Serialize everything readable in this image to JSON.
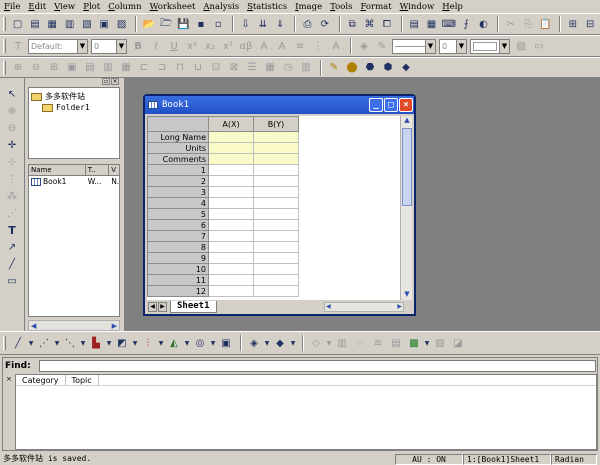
{
  "menu": [
    "File",
    "Edit",
    "View",
    "Plot",
    "Column",
    "Worksheet",
    "Analysis",
    "Statistics",
    "Image",
    "Tools",
    "Format",
    "Window",
    "Help"
  ],
  "format_toolbar": {
    "font": "Default:",
    "size": "0",
    "width": "0"
  },
  "explorer": {
    "root": "多多软件站",
    "folder": "Folder1",
    "columns": [
      "Name",
      "T..",
      "V"
    ],
    "rows": [
      {
        "name": "Book1",
        "type": "W...",
        "view": "N."
      }
    ]
  },
  "book": {
    "title": "Book1",
    "columns": [
      "A(X)",
      "B(Y)"
    ],
    "meta_rows": [
      "Long Name",
      "Units",
      "Comments"
    ],
    "row_numbers": [
      "1",
      "2",
      "3",
      "4",
      "5",
      "6",
      "7",
      "8",
      "9",
      "10",
      "11",
      "12"
    ],
    "sheet_tab": "Sheet1"
  },
  "find": {
    "label": "Find:",
    "value": "",
    "columns": [
      "Category",
      "Topic"
    ]
  },
  "status": {
    "message": "多多软件站 is saved.",
    "au": "AU : ON",
    "sheet": "1:[Book1]Sheet1",
    "angle": "Radian"
  }
}
